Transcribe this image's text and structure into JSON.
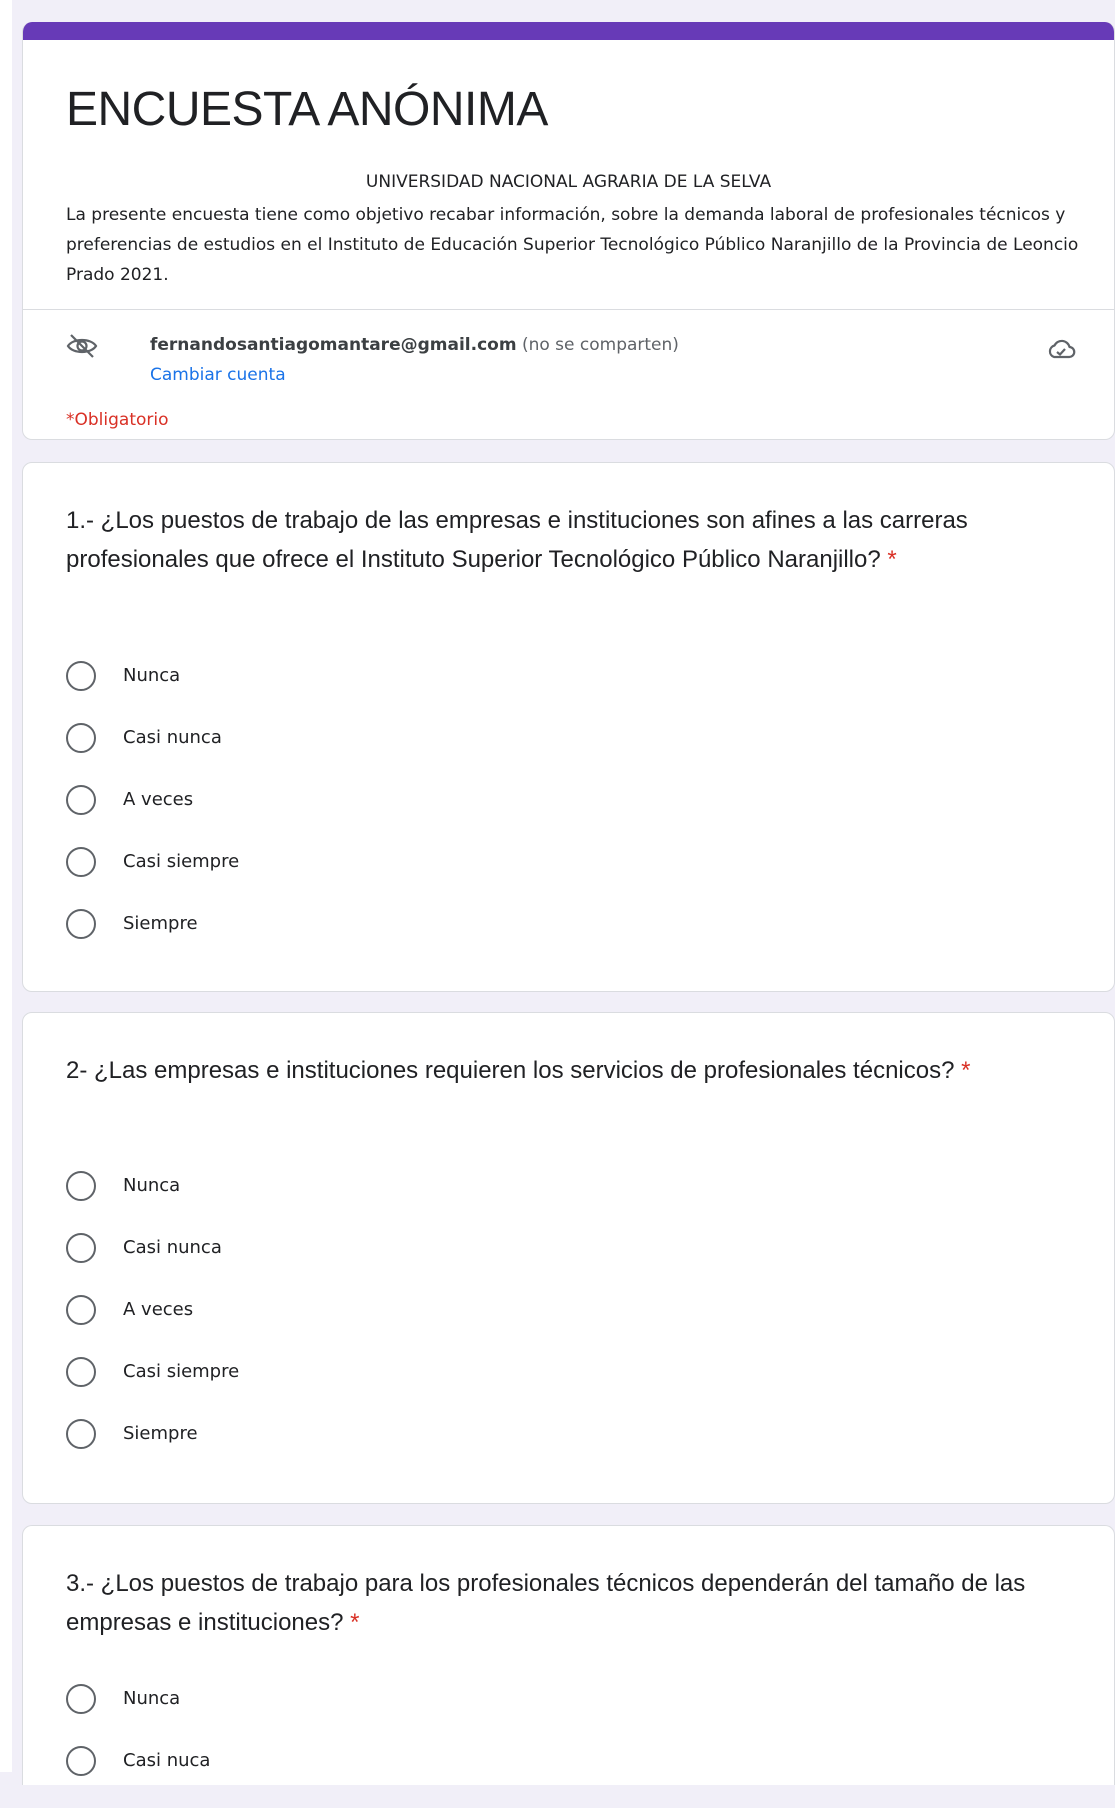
{
  "form": {
    "title": "ENCUESTA ANÓNIMA",
    "subtitle": "UNIVERSIDAD NACIONAL AGRARIA DE LA SELVA",
    "description": "La presente encuesta tiene como objetivo recabar información, sobre la demanda laboral de profesionales técnicos y preferencias de estudios en el Instituto de Educación Superior Tecnológico Público Naranjillo de la Provincia de Leoncio Prado 2021.",
    "accent_color": "#673ab7",
    "account": {
      "email": "fernandosantiagomantare@gmail.com",
      "note": "(no se comparten)",
      "switch_label": "Cambiar cuenta",
      "privacy_icon": "eye-off-icon",
      "save_status_icon": "cloud-icon"
    },
    "required_note": "*Obligatorio"
  },
  "questions": [
    {
      "title": "1.- ¿Los puestos de trabajo de las empresas e instituciones son afines a las carreras profesionales que ofrece el Instituto Superior Tecnológico Público Naranjillo?",
      "required_mark": "*",
      "options": [
        "Nunca",
        "Casi nunca",
        "A veces",
        "Casi siempre",
        "Siempre"
      ]
    },
    {
      "title": "2- ¿Las empresas e instituciones requieren los servicios de profesionales técnicos?",
      "required_mark": "*",
      "options": [
        "Nunca",
        "Casi nunca",
        "A veces",
        "Casi siempre",
        "Siempre"
      ]
    },
    {
      "title": "3.- ¿Los puestos de trabajo para los profesionales técnicos dependerán del tamaño de las empresas e instituciones?",
      "required_mark": "*",
      "options": [
        "Nunca",
        "Casi nuca"
      ]
    }
  ]
}
